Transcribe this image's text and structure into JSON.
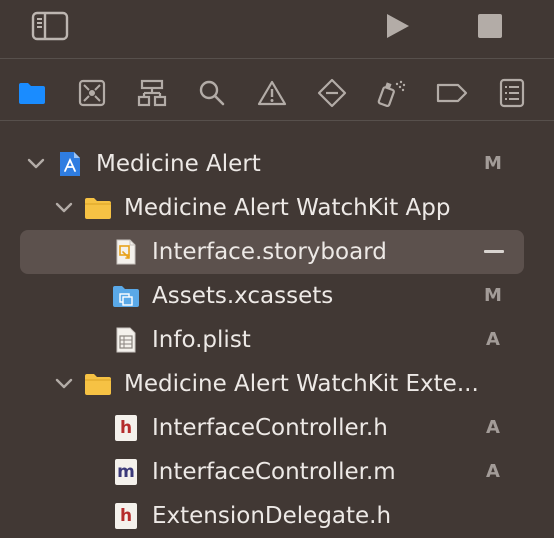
{
  "toolbar": {
    "sidebar_toggle_icon": "sidebar-toggle-icon",
    "run_icon": "play-icon",
    "stop_icon": "stop-icon"
  },
  "navigator_tabs": [
    {
      "name": "project-navigator",
      "icon": "folder-icon",
      "active": true
    },
    {
      "name": "source-control-navigator",
      "icon": "source-control-icon",
      "active": false
    },
    {
      "name": "symbol-navigator",
      "icon": "hierarchy-icon",
      "active": false
    },
    {
      "name": "find-navigator",
      "icon": "search-icon",
      "active": false
    },
    {
      "name": "issue-navigator",
      "icon": "warning-icon",
      "active": false
    },
    {
      "name": "test-navigator",
      "icon": "diamond-icon",
      "active": false
    },
    {
      "name": "debug-navigator",
      "icon": "spray-icon",
      "active": false
    },
    {
      "name": "breakpoint-navigator",
      "icon": "tag-icon",
      "active": false
    },
    {
      "name": "report-navigator",
      "icon": "report-icon",
      "active": false
    }
  ],
  "colors": {
    "accent": "#1a8cff",
    "background": "#413834",
    "selection": "#5c514d",
    "folder": "#f6c244"
  },
  "tree": {
    "rows": [
      {
        "label": "Medicine Alert",
        "status": "M",
        "icon": "xcode-project-icon"
      },
      {
        "label": "Medicine Alert WatchKit App",
        "status": "",
        "icon": "folder-icon"
      },
      {
        "label": "Interface.storyboard",
        "status": "",
        "icon": "storyboard-file-icon"
      },
      {
        "label": "Assets.xcassets",
        "status": "M",
        "icon": "asset-catalog-icon"
      },
      {
        "label": "Info.plist",
        "status": "A",
        "icon": "plist-file-icon"
      },
      {
        "label": "Medicine Alert WatchKit Exte...",
        "status": "",
        "icon": "folder-icon"
      },
      {
        "label": "InterfaceController.h",
        "status": "A",
        "icon": "header-file-icon",
        "letter": "h"
      },
      {
        "label": "InterfaceController.m",
        "status": "A",
        "icon": "objc-file-icon",
        "letter": "m"
      },
      {
        "label": "ExtensionDelegate.h",
        "status": "",
        "icon": "header-file-icon",
        "letter": "h"
      }
    ]
  }
}
